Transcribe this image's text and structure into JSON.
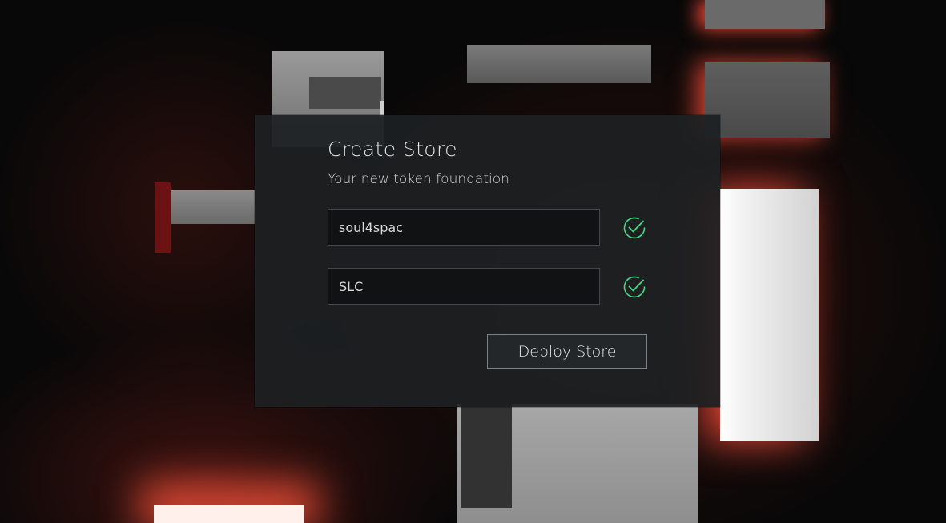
{
  "dialog": {
    "title": "Create Store",
    "subtitle": "Your new token foundation",
    "name_field": {
      "value": "soul4spac"
    },
    "symbol_field": {
      "value": "SLC"
    },
    "name_status_icon": "check-circle-icon",
    "symbol_status_icon": "check-circle-icon",
    "deploy_label": "Deploy Store"
  },
  "colors": {
    "dialog_bg": "#1d2022",
    "valid_check": "#3ddc84",
    "neon_glow": "#ff5a45"
  }
}
